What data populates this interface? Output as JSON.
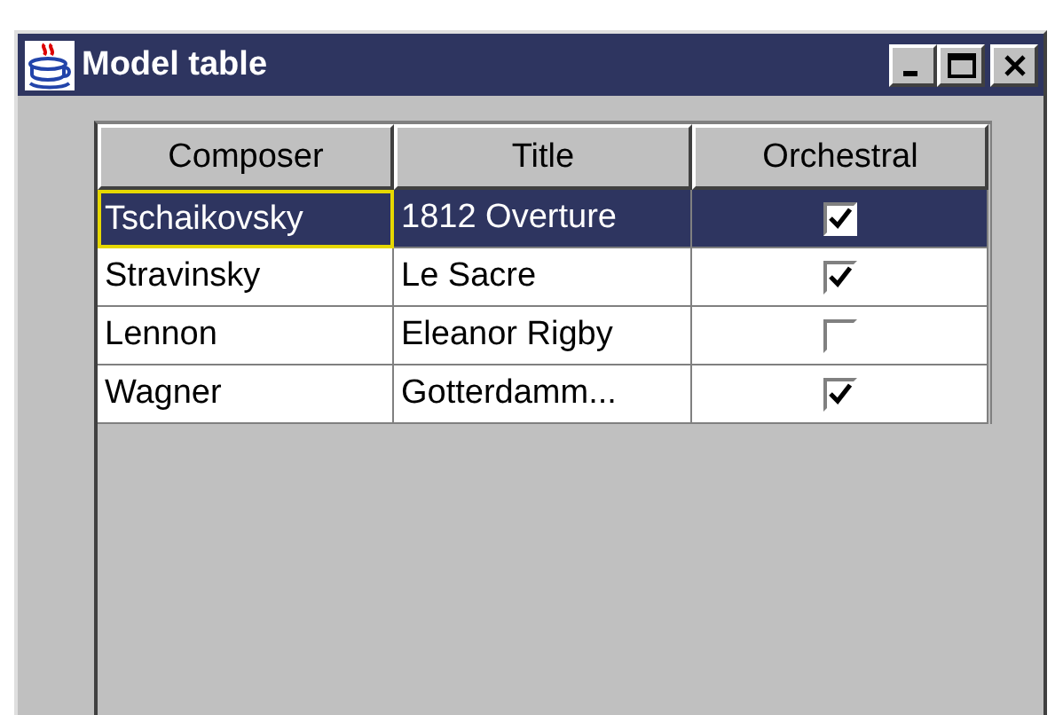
{
  "window": {
    "title": "Model table"
  },
  "table": {
    "columns": [
      "Composer",
      "Title",
      "Orchestral"
    ],
    "rows": [
      {
        "cells": [
          {
            "text": "Tschaikovsky",
            "focused": true
          },
          {
            "text": "1812 Overture",
            "focused": false
          }
        ],
        "orchestral": true,
        "selected": true
      },
      {
        "cells": [
          {
            "text": "Stravinsky",
            "focused": false
          },
          {
            "text": "Le Sacre",
            "focused": false
          }
        ],
        "orchestral": true,
        "selected": false
      },
      {
        "cells": [
          {
            "text": "Lennon",
            "focused": false
          },
          {
            "text": "Eleanor Rigby",
            "focused": false
          }
        ],
        "orchestral": false,
        "selected": false
      },
      {
        "cells": [
          {
            "text": "Wagner",
            "focused": false
          },
          {
            "text": "Gotterdamm...",
            "focused": false
          }
        ],
        "orchestral": true,
        "selected": false
      }
    ]
  }
}
